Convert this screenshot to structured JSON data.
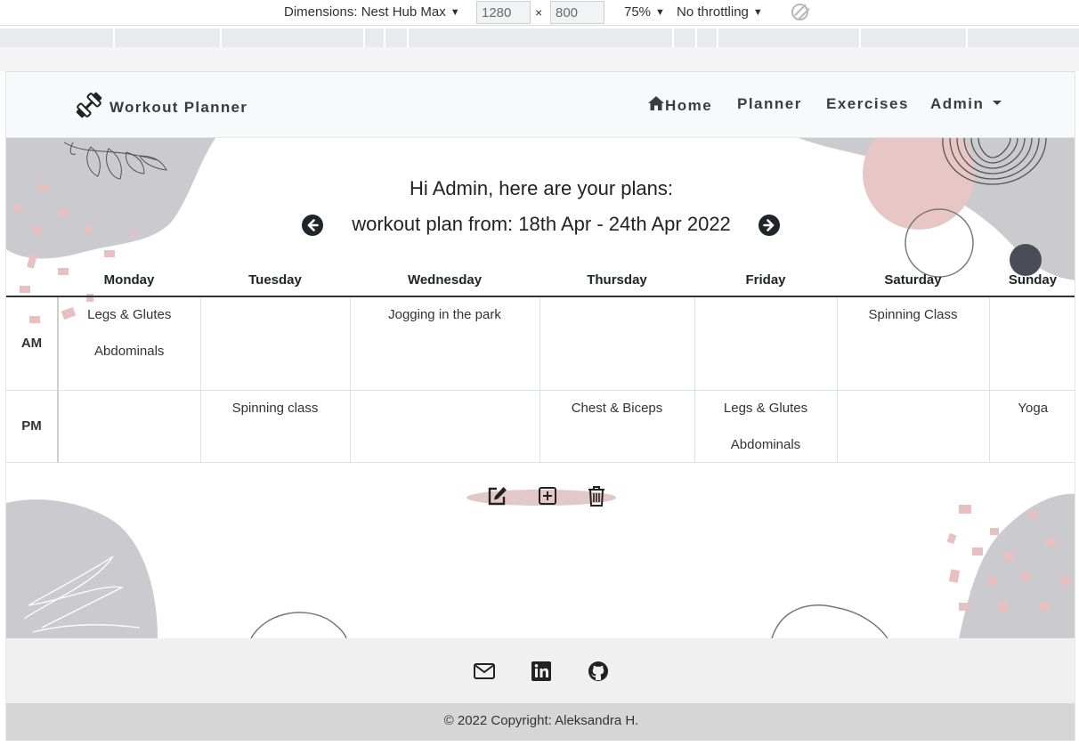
{
  "devtools": {
    "dimensions_label": "Dimensions: Nest Hub Max",
    "width": "1280",
    "height": "800",
    "times": "×",
    "zoom": "75%",
    "throttling": "No throttling",
    "rotate_icon": "rotate-icon"
  },
  "navbar": {
    "brand_icon": "dumbbell-icon",
    "brand": "Workout Planner",
    "home_icon": "home-icon",
    "links": {
      "home": "Home",
      "planner": "Planner",
      "exercises": "Exercises",
      "admin": "Admin"
    }
  },
  "main": {
    "greeting": "Hi Admin, here are your plans:",
    "week_label": "workout plan from: 18th Apr - 24th Apr 2022",
    "prev_icon": "arrow-left-circle-icon",
    "next_icon": "arrow-right-circle-icon"
  },
  "table": {
    "days": [
      "Monday",
      "Tuesday",
      "Wednesday",
      "Thursday",
      "Friday",
      "Saturday",
      "Sunday"
    ],
    "rows": [
      {
        "label": "AM",
        "cells": [
          [
            "Legs & Glutes",
            "Abdominals"
          ],
          [],
          [
            "Jogging in the park"
          ],
          [],
          [],
          [
            "Spinning Class"
          ],
          []
        ]
      },
      {
        "label": "PM",
        "cells": [
          [],
          [
            "Spinning class"
          ],
          [],
          [
            "Chest & Biceps"
          ],
          [
            "Legs & Glutes",
            "Abdominals"
          ],
          [],
          [
            "Yoga"
          ]
        ]
      }
    ]
  },
  "actions": {
    "edit_icon": "edit-icon",
    "add_icon": "plus-square-icon",
    "delete_icon": "trash-icon"
  },
  "footer": {
    "icons": [
      "envelope-icon",
      "linkedin-icon",
      "github-icon"
    ],
    "copyright": "© 2022 Copyright: Aleksandra H."
  },
  "colors": {
    "accent_pink": "#e8c4c4",
    "dark": "#212529",
    "footer_bg": "#f0f0f0",
    "copyright_bg": "#d6d6d6"
  }
}
